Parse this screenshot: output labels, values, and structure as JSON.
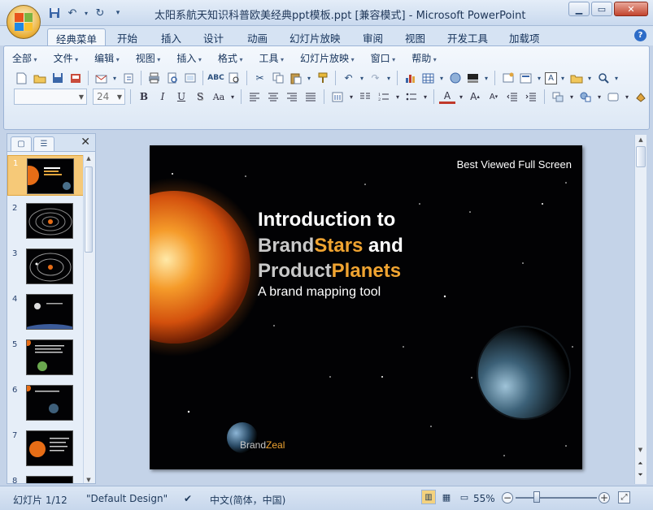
{
  "window": {
    "title": "太阳系航天知识科普欧美经典ppt模板.ppt [兼容模式] - Microsoft PowerPoint"
  },
  "quick_access": [
    "save-icon",
    "undo-icon",
    "redo-icon",
    "customize-icon"
  ],
  "ribbon_tabs": [
    "经典菜单",
    "开始",
    "插入",
    "设计",
    "动画",
    "幻灯片放映",
    "审阅",
    "视图",
    "开发工具",
    "加载项"
  ],
  "active_tab": "经典菜单",
  "classic_menu": [
    "全部",
    "文件",
    "编辑",
    "视图",
    "插入",
    "格式",
    "工具",
    "幻灯片放映",
    "窗口",
    "帮助"
  ],
  "font_size_value": "24",
  "font_name_value": "",
  "panes": {
    "tab_slides_icon": "slides-tab-icon",
    "tab_outline_icon": "outline-tab-icon",
    "close_glyph": "✕"
  },
  "thumbnails": [
    "1",
    "2",
    "3",
    "4",
    "5",
    "6",
    "7",
    "8"
  ],
  "selected_thumbnail": 1,
  "slide": {
    "corner_text": "Best Viewed Full Screen",
    "line1": "Introduction to",
    "line2_a": "Brand",
    "line2_b": "Stars",
    "line2_c": " and",
    "line3_a": "Product",
    "line3_b": "Planets",
    "subtitle": "A brand mapping tool",
    "logo_a": "Brand",
    "logo_b": "Zeal",
    "colors": {
      "accent": "#f0a431",
      "gray": "#c8c8c8",
      "white": "#ffffff",
      "background": "#020204"
    }
  },
  "status": {
    "slide_indicator": "幻灯片 1/12",
    "theme": "\"Default Design\"",
    "language": "中文(简体，中国)",
    "zoom": "55%"
  }
}
